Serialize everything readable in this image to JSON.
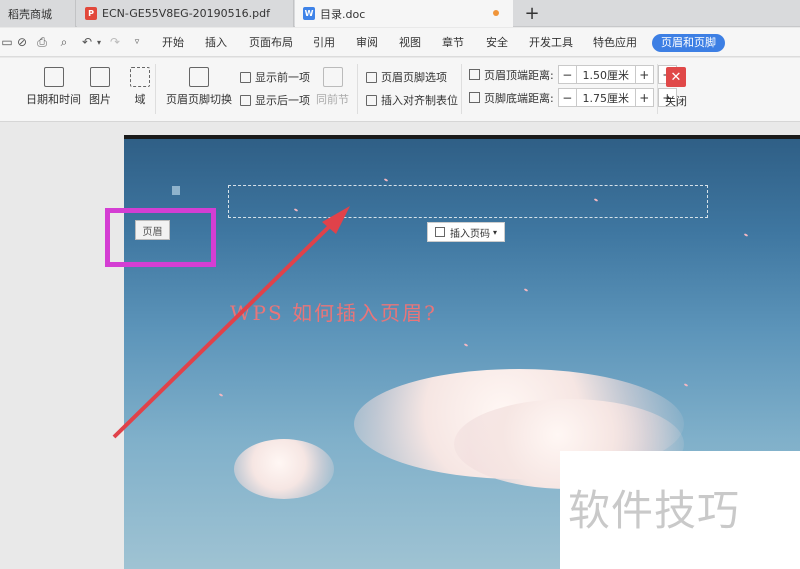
{
  "tabs": [
    {
      "label": "稻壳商城",
      "icon": "none"
    },
    {
      "label": "ECN-GE55V8EG-20190516.pdf",
      "icon": "pdf-icon"
    },
    {
      "label": "目录.doc",
      "icon": "word-icon",
      "active": true,
      "unsaved": true
    }
  ],
  "menu": {
    "items": [
      "开始",
      "插入",
      "页面布局",
      "引用",
      "审阅",
      "视图",
      "章节",
      "安全",
      "开发工具",
      "特色应用"
    ],
    "active": "页眉和页脚"
  },
  "ribbon": {
    "date_time": "日期和时间",
    "picture": "图片",
    "field": "域",
    "switch": "页眉页脚切换",
    "show_prev": "显示前一项",
    "show_next": "显示后一项",
    "same_as_prev": "同前节",
    "options": "页眉页脚选项",
    "insert_align_tab": "插入对齐制表位",
    "header_top_label": "页眉顶端距离:",
    "header_top_value": "1.50厘米",
    "footer_bottom_label": "页脚底端距离:",
    "footer_bottom_value": "1.75厘米",
    "close": "关闭"
  },
  "document": {
    "header_label": "页眉",
    "insert_page_number": "插入页码",
    "title": "WPS 如何插入页眉?",
    "watermark": "软件技巧"
  },
  "colors": {
    "accent": "#3d7fe4",
    "highlight_box": "#d43ed3",
    "arrow": "#e0424a",
    "title": "#e97579"
  }
}
